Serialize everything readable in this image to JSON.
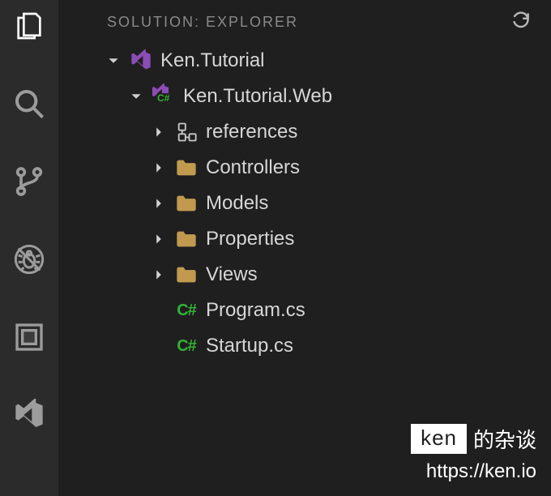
{
  "panel": {
    "title": "SOLUTION: EXPLORER"
  },
  "tree": {
    "root": {
      "label": "Ken.Tutorial",
      "child": {
        "label": "Ken.Tutorial.Web",
        "items": [
          {
            "label": "references",
            "icon": "references",
            "expandable": true
          },
          {
            "label": "Controllers",
            "icon": "folder",
            "expandable": true
          },
          {
            "label": "Models",
            "icon": "folder",
            "expandable": true
          },
          {
            "label": "Properties",
            "icon": "folder",
            "expandable": true
          },
          {
            "label": "Views",
            "icon": "folder",
            "expandable": true
          },
          {
            "label": "Program.cs",
            "icon": "csharp",
            "expandable": false
          },
          {
            "label": "Startup.cs",
            "icon": "csharp",
            "expandable": false
          }
        ]
      }
    }
  },
  "watermark": {
    "badge": "ken",
    "suffix": "的杂谈",
    "url": "https://ken.io"
  },
  "csharp_glyph": "C#"
}
